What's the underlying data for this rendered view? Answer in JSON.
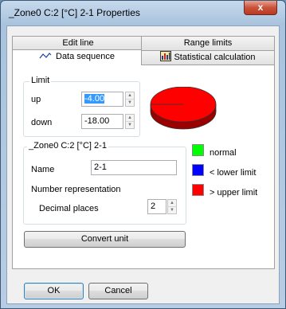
{
  "window": {
    "title": "_Zone0 C:2 [°C] 2-1 Properties",
    "close_glyph": "x"
  },
  "tabs": [
    {
      "label": "Edit line",
      "active": false
    },
    {
      "label": "Range limits",
      "active": false
    },
    {
      "label": "Data sequence",
      "active": true,
      "icon": "wave-icon"
    },
    {
      "label": "Statistical calculation",
      "active": false,
      "icon": "statistics-icon"
    }
  ],
  "limit": {
    "title": "Limit",
    "up_label": "up",
    "up_value": "-4.00",
    "down_label": "down",
    "down_value": "-18.00"
  },
  "channel": {
    "title": "_Zone0 C:2 [°C] 2-1",
    "name_label": "Name",
    "name_value": "2-1",
    "number_rep_label": "Number representation",
    "decimal_label": "Decimal places",
    "decimal_value": "2"
  },
  "convert_button": "Convert unit",
  "legend": [
    {
      "label": "normal",
      "color": "#00ff00"
    },
    {
      "label": "< lower limit",
      "color": "#0000ff"
    },
    {
      "label": "> upper limit",
      "color": "#ff0000"
    }
  ],
  "pie_color": "#ff0000",
  "footer": {
    "ok": "OK",
    "cancel": "Cancel"
  }
}
